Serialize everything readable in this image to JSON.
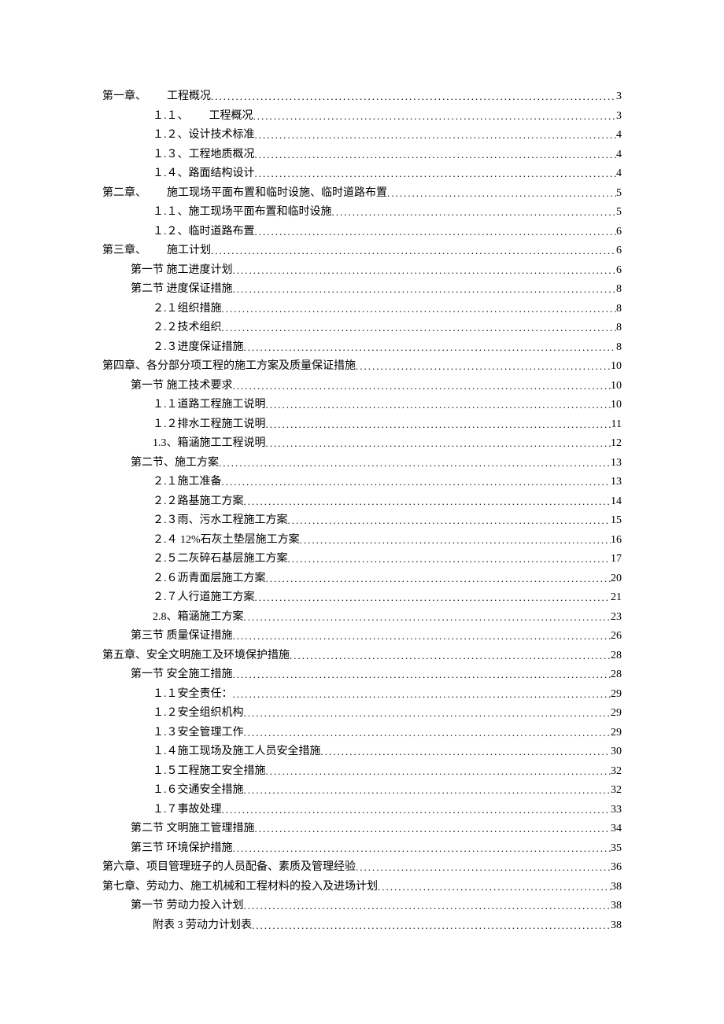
{
  "toc": [
    {
      "level": 0,
      "title": "第一章、",
      "suffix": "工程概况",
      "gap": true,
      "page": "3"
    },
    {
      "level": 2,
      "title": "１.１、",
      "suffix": "工程概况",
      "gap": true,
      "page": "3"
    },
    {
      "level": 2,
      "title": "１.２、设计技术标准",
      "page": "4"
    },
    {
      "level": 2,
      "title": "１.３、工程地质概况",
      "page": "4"
    },
    {
      "level": 2,
      "title": "１.４、路面结构设计",
      "page": "4"
    },
    {
      "level": 0,
      "title": "第二章、",
      "suffix": "施工现场平面布置和临时设施、临时道路布置",
      "gap": true,
      "page": "5"
    },
    {
      "level": 2,
      "title": "１.１、施工现场平面布置和临时设施",
      "page": "5"
    },
    {
      "level": 2,
      "title": "１.２、临时道路布置",
      "page": "6"
    },
    {
      "level": 0,
      "title": "第三章、",
      "suffix": "施工计划",
      "gap": true,
      "page": "6"
    },
    {
      "level": 1,
      "title": "第一节 施工进度计划",
      "page": "6"
    },
    {
      "level": 1,
      "title": "第二节 进度保证措施",
      "page": "8"
    },
    {
      "level": 2,
      "title": "２.１组织措施",
      "page": "8"
    },
    {
      "level": 2,
      "title": "２.２技术组织",
      "page": "8"
    },
    {
      "level": 2,
      "title": "２.３进度保证措施",
      "page": "8"
    },
    {
      "level": 0,
      "title": "第四章、各分部分项工程的施工方案及质量保证措施",
      "page": "10"
    },
    {
      "level": 1,
      "title": "第一节 施工技术要求",
      "page": "10"
    },
    {
      "level": 2,
      "title": "１.１道路工程施工说明",
      "page": "10"
    },
    {
      "level": 2,
      "title": "１.２排水工程施工说明",
      "page": "11"
    },
    {
      "level": 2,
      "title": "1.3、箱涵施工工程说明",
      "page": "12"
    },
    {
      "level": 1,
      "title": "第二节、施工方案",
      "page": "13"
    },
    {
      "level": 2,
      "title": "２.１施工准备",
      "page": "13"
    },
    {
      "level": 2,
      "title": "２.２路基施工方案",
      "page": "14"
    },
    {
      "level": 2,
      "title": "２.３雨、污水工程施工方案",
      "page": "15"
    },
    {
      "level": 2,
      "title": "２.４  12%石灰土垫层施工方案",
      "page": "16"
    },
    {
      "level": 2,
      "title": "２.５二灰碎石基层施工方案",
      "page": "17"
    },
    {
      "level": 2,
      "title": "２.６沥青面层施工方案",
      "page": "20"
    },
    {
      "level": 2,
      "title": "２.７人行道施工方案",
      "page": "21"
    },
    {
      "level": 2,
      "title": "2.8、箱涵施工方案",
      "page": "23"
    },
    {
      "level": 1,
      "title": "第三节 质量保证措施",
      "page": "26"
    },
    {
      "level": 0,
      "title": "第五章、安全文明施工及环境保护措施",
      "page": "28"
    },
    {
      "level": 1,
      "title": "第一节 安全施工措施",
      "page": "28"
    },
    {
      "level": 2,
      "title": "１.１安全责任：",
      "page": "29"
    },
    {
      "level": 2,
      "title": "１.２安全组织机构",
      "page": "29"
    },
    {
      "level": 2,
      "title": "１.３安全管理工作",
      "page": "29"
    },
    {
      "level": 2,
      "title": "１.４施工现场及施工人员安全措施",
      "page": "30"
    },
    {
      "level": 2,
      "title": "１.５工程施工安全措施",
      "page": "32"
    },
    {
      "level": 2,
      "title": "１.６交通安全措施",
      "page": "32"
    },
    {
      "level": 2,
      "title": "１.７事故处理",
      "page": "33"
    },
    {
      "level": 1,
      "title": "第二节 文明施工管理措施",
      "page": "34"
    },
    {
      "level": 1,
      "title": "第三节 环境保护措施",
      "page": "35"
    },
    {
      "level": 0,
      "title": "第六章、项目管理班子的人员配备、素质及管理经验",
      "page": "36"
    },
    {
      "level": 0,
      "title": "第七章、劳动力、施工机械和工程材料的投入及进场计划",
      "page": "38"
    },
    {
      "level": 1,
      "title": "第一节 劳动力投入计划",
      "page": "38"
    },
    {
      "level": 2,
      "title": "附表 3 劳动力计划表",
      "page": "38"
    }
  ]
}
